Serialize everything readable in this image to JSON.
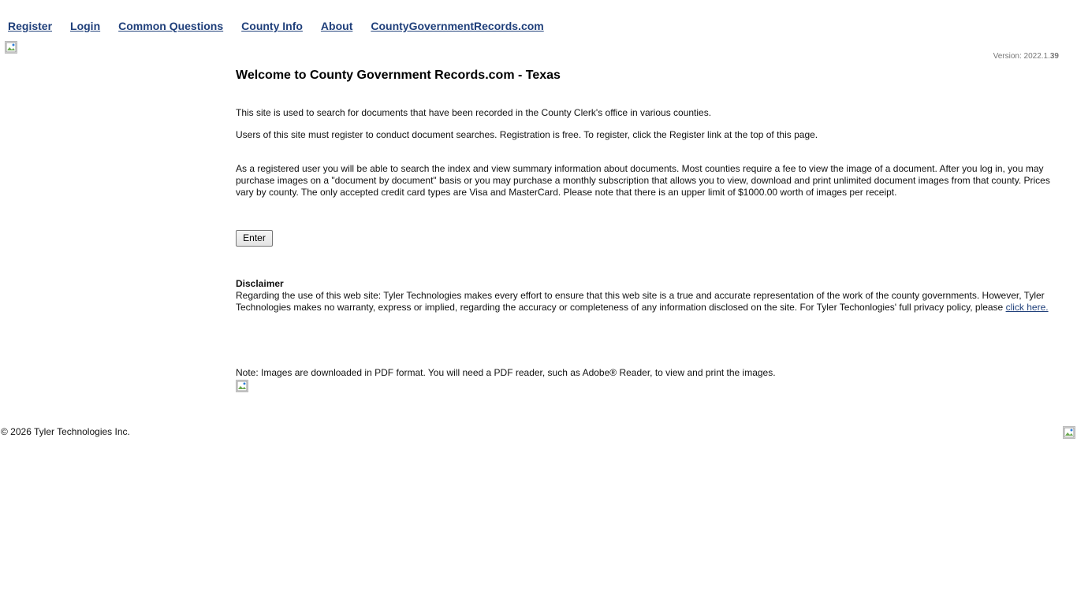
{
  "nav": {
    "items": [
      {
        "label": "Register"
      },
      {
        "label": "Login"
      },
      {
        "label": "Common Questions"
      },
      {
        "label": "County Info"
      },
      {
        "label": "About"
      },
      {
        "label": "CountyGovernmentRecords.com"
      }
    ]
  },
  "version": {
    "prefix": "Version: 2022.1.",
    "build": "39"
  },
  "main": {
    "title": "Welcome to County Government Records.com - Texas",
    "paragraph_1": "This site is used to search for documents that have been recorded in the County Clerk's office in various counties.",
    "paragraph_2": "Users of this site must register to conduct document searches. Registration is free. To register, click the Register link at the top of this page.",
    "paragraph_3": "As a registered user you will be able to search the index and view summary information about documents. Most counties require a fee to view the image of a document. After you log in, you may purchase images on a \"document by document\" basis or you may purchase a monthly subscription that allows you to view, download and print unlimited document images from that county. Prices vary by county. The only accepted credit card types are Visa and MasterCard. Please note that there is an upper limit of $1000.00 worth of images per receipt.",
    "enter_label": "Enter"
  },
  "disclaimer": {
    "heading": "Disclaimer",
    "text": "Regarding the use of this web site: Tyler Technologies makes every effort to ensure that this web site is a true and accurate representation of the work of the county governments. However, Tyler Technologies makes no warranty, express or implied, regarding the accuracy or completeness of any information disclosed on the site. For Tyler Techonlogies' full privacy policy, please",
    "link_label": "click here."
  },
  "note": {
    "text": "Note: Images are downloaded in PDF format. You will need a PDF reader, such as Adobe® Reader, to view and print the images."
  },
  "footer": {
    "copyright": "© 2026 Tyler Technologies Inc."
  },
  "colors": {
    "link": "#1f3f7a",
    "text": "#111111",
    "version_text": "#777777"
  },
  "icons": {
    "top_image": "broken-image-icon",
    "content_image": "broken-image-icon",
    "footer_image": "broken-image-icon"
  }
}
